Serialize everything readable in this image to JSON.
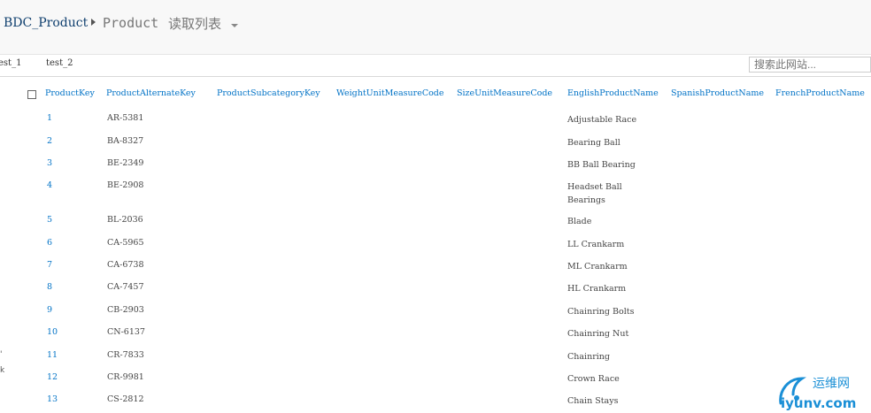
{
  "breadcrumb": {
    "site": "BDC_Product",
    "list": "Product",
    "view": "读取列表"
  },
  "tabs": [
    {
      "label": "est_1"
    },
    {
      "label": "test_2"
    }
  ],
  "search": {
    "placeholder": "搜索此网站..."
  },
  "columns": [
    "ProductKey",
    "ProductAlternateKey",
    "ProductSubcategoryKey",
    "WeightUnitMeasureCode",
    "SizeUnitMeasureCode",
    "EnglishProductName",
    "SpanishProductName",
    "FrenchProductName"
  ],
  "rows": [
    {
      "key": "1",
      "alt": "AR-5381",
      "eng": "Adjustable Race"
    },
    {
      "key": "2",
      "alt": "BA-8327",
      "eng": "Bearing Ball"
    },
    {
      "key": "3",
      "alt": "BE-2349",
      "eng": "BB Ball Bearing"
    },
    {
      "key": "4",
      "alt": "BE-2908",
      "eng": "Headset Ball Bearings"
    },
    {
      "key": "5",
      "alt": "BL-2036",
      "eng": "Blade"
    },
    {
      "key": "6",
      "alt": "CA-5965",
      "eng": "LL Crankarm"
    },
    {
      "key": "7",
      "alt": "CA-6738",
      "eng": "ML Crankarm"
    },
    {
      "key": "8",
      "alt": "CA-7457",
      "eng": "HL Crankarm"
    },
    {
      "key": "9",
      "alt": "CB-2903",
      "eng": "Chainring Bolts"
    },
    {
      "key": "10",
      "alt": "CN-6137",
      "eng": "Chainring Nut"
    },
    {
      "key": "11",
      "alt": "CR-7833",
      "eng": "Chainring"
    },
    {
      "key": "12",
      "alt": "CR-9981",
      "eng": "Crown Race"
    },
    {
      "key": "13",
      "alt": "CS-2812",
      "eng": "Chain Stays"
    }
  ],
  "watermark": {
    "text1": "运维网",
    "text2": "iyunv.com"
  },
  "colors": {
    "link": "#0072c6",
    "breadcrumb": "#0f3f6e",
    "watermark": "#1a8fd6"
  }
}
